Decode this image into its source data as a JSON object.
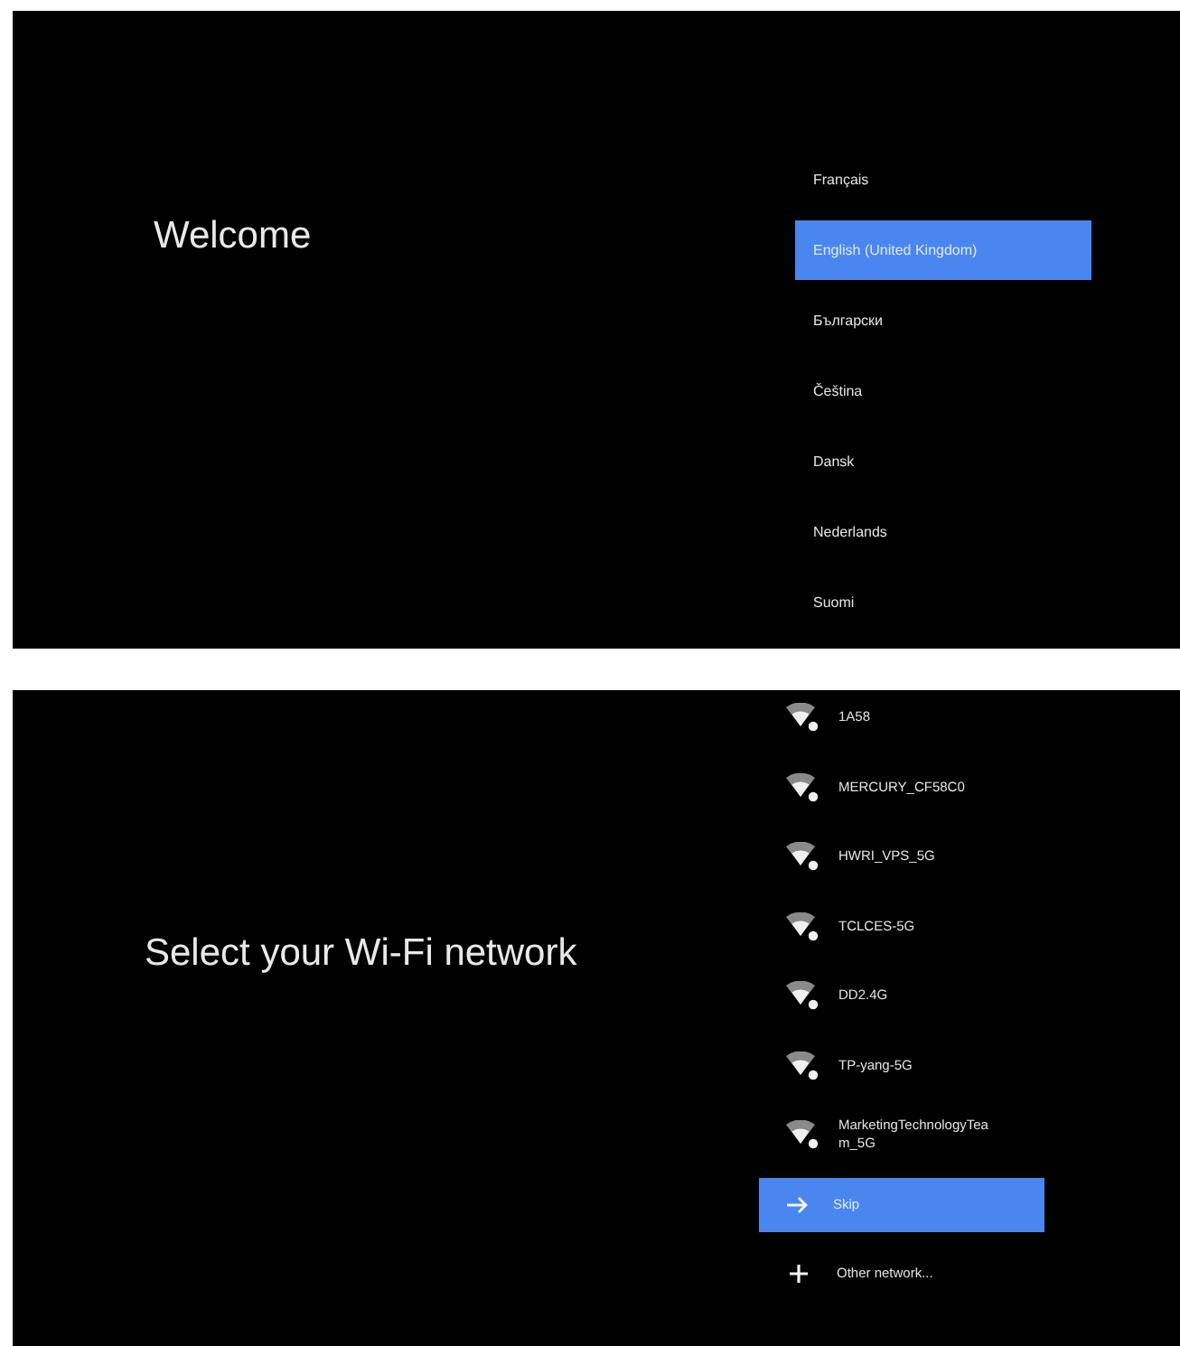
{
  "language_screen": {
    "title": "Welcome",
    "languages": [
      {
        "label": "Français",
        "selected": false
      },
      {
        "label": "English (United Kingdom)",
        "selected": true
      },
      {
        "label": "Български",
        "selected": false
      },
      {
        "label": "Čeština",
        "selected": false
      },
      {
        "label": "Dansk",
        "selected": false
      },
      {
        "label": "Nederlands",
        "selected": false
      },
      {
        "label": "Suomi",
        "selected": false
      }
    ]
  },
  "wifi_screen": {
    "title": "Select your Wi-Fi network",
    "items": [
      {
        "kind": "network",
        "label": "1A58",
        "selected": false
      },
      {
        "kind": "network",
        "label": "MERCURY_CF58C0",
        "selected": false
      },
      {
        "kind": "network",
        "label": "HWRI_VPS_5G",
        "selected": false
      },
      {
        "kind": "network",
        "label": "TCLCES-5G",
        "selected": false
      },
      {
        "kind": "network",
        "label": "DD2.4G",
        "selected": false
      },
      {
        "kind": "network",
        "label": "TP-yang-5G",
        "selected": false
      },
      {
        "kind": "network",
        "label": "MarketingTechnologyTeam_5G",
        "selected": false
      },
      {
        "kind": "skip",
        "label": "Skip",
        "selected": true
      },
      {
        "kind": "add",
        "label": "Other network...",
        "selected": false
      }
    ]
  }
}
